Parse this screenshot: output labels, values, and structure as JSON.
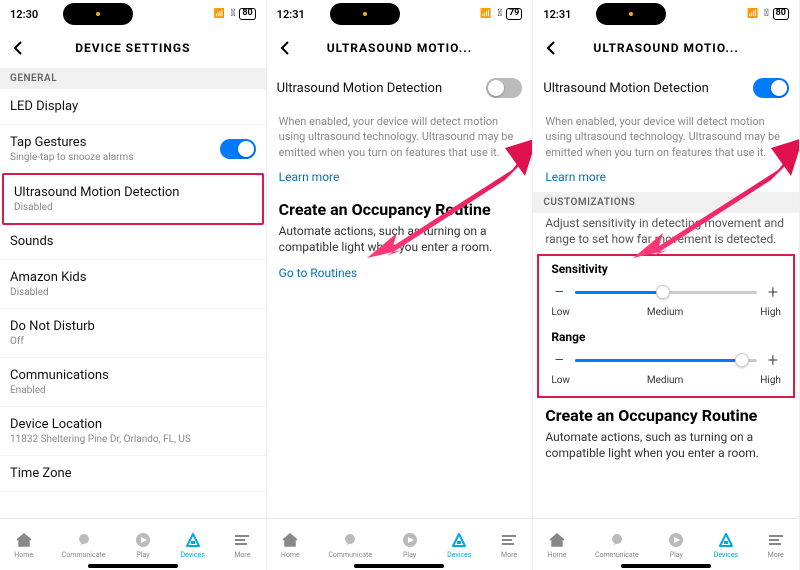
{
  "statusBattery": [
    "80",
    "79",
    "80"
  ],
  "screens": [
    {
      "time": "12:30",
      "title": "DEVICE SETTINGS",
      "sectionGeneral": "GENERAL",
      "rows": {
        "ledDisplay": "LED Display",
        "tapGestures": "Tap Gestures",
        "tapGesturesSub": "Single-tap to snooze alarms",
        "ultrasound": "Ultrasound Motion Detection",
        "ultrasoundSub": "Disabled",
        "sounds": "Sounds",
        "amazonKids": "Amazon Kids",
        "amazonKidsSub": "Disabled",
        "dnd": "Do Not Disturb",
        "dndSub": "Off",
        "comm": "Communications",
        "commSub": "Enabled",
        "location": "Device Location",
        "locationSub": "11832 Sheltering Pine Dr, Orlando, FL, US",
        "timezone": "Time Zone"
      }
    },
    {
      "time": "12:31",
      "title": "ULTRASOUND MOTIO...",
      "umd": "Ultrasound Motion Detection",
      "umdToggle": "off",
      "body": "When enabled, your device will detect motion using ultrasound technology. Ultrasound may be emitted when you turn on features that use it.",
      "learnMore": "Learn more",
      "routineTitle": "Create an Occupancy Routine",
      "routineBody": "Automate actions, such as turning on a compatible light when you enter a room.",
      "goRoutines": "Go to Routines"
    },
    {
      "time": "12:31",
      "title": "ULTRASOUND MOTIO...",
      "umd": "Ultrasound Motion Detection",
      "umdToggle": "on",
      "body": "When enabled, your device will detect motion using ultrasound technology. Ultrasound may be emitted when you turn on features that use it.",
      "learnMore": "Learn more",
      "customizations": "CUSTOMIZATIONS",
      "custBody": "Adjust sensitivity in detecting movement and range to set how far movement is detected.",
      "sensitivity": {
        "label": "Sensitivity",
        "low": "Low",
        "med": "Medium",
        "high": "High",
        "pct": 48
      },
      "range": {
        "label": "Range",
        "low": "Low",
        "med": "Medium",
        "high": "High",
        "pct": 92
      },
      "routineTitle": "Create an Occupancy Routine",
      "routineBody": "Automate actions, such as turning on a compatible light when you enter a room."
    }
  ],
  "tabs": {
    "home": "Home",
    "comm": "Communicate",
    "play": "Play",
    "devices": "Devices",
    "more": "More"
  }
}
